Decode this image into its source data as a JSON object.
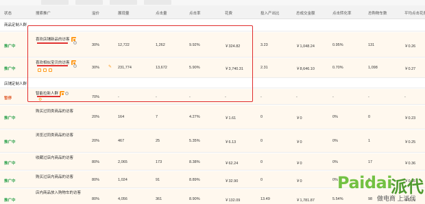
{
  "header": {
    "columns": [
      "状态",
      "搜索推广",
      "溢价",
      "展现量",
      "点击量",
      "点击率",
      "花费",
      "投入产出比",
      "总成交金额",
      "点击转化率",
      "总购物车数",
      "平均点击花费"
    ]
  },
  "groups": {
    "shop_custom": "商品定制人群",
    "store_custom": "店铺定制人群"
  },
  "rows": [
    {
      "status": "推广中",
      "name": "喜欢店铺新品的访客",
      "premium": "30%",
      "impressions": "12,722",
      "clicks": "1,262",
      "ctr": "9.92%",
      "cost": "￥324.82",
      "roi": "3.23",
      "gmv": "￥1,048.24",
      "cvr": "0.95%",
      "carts": "131",
      "cpc": "￥0.26"
    },
    {
      "status": "推广中",
      "name": "喜欢相似宝贝的访客",
      "premium": "30%",
      "impressions": "231,774",
      "clicks": "13,672",
      "ctr": "5.90%",
      "cost": "￥3,740.31",
      "roi": "2.31",
      "gmv": "￥8,646.10",
      "cvr": "0.70%",
      "carts": "1,098",
      "cpc": "￥0.27"
    },
    {
      "status": "暂停",
      "name": "智能拉新人群",
      "premium": "70%",
      "impressions": "-",
      "clicks": "-",
      "ctr": "-",
      "cost": "-",
      "roi": "-",
      "gmv": "-",
      "cvr": "-",
      "carts": "-",
      "cpc": "-"
    },
    {
      "status": "推广中",
      "name": "购买过同类商品的访客",
      "premium": "20%",
      "impressions": "164",
      "clicks": "7",
      "ctr": "4.27%",
      "cost": "￥1.61",
      "roi": "0",
      "gmv": "￥0",
      "cvr": "0%",
      "carts": "0",
      "cpc": "￥0.23"
    },
    {
      "status": "推广中",
      "name": "浏览过同类商品的访客",
      "premium": "20%",
      "impressions": "467",
      "clicks": "25",
      "ctr": "5.35%",
      "cost": "￥6.13",
      "roi": "0",
      "gmv": "￥0",
      "cvr": "0%",
      "carts": "1",
      "cpc": "￥0.25"
    },
    {
      "status": "推广中",
      "name": "收藏过店内商品的访客",
      "premium": "80%",
      "impressions": "2,065",
      "clicks": "173",
      "ctr": "8.38%",
      "cost": "￥62.24",
      "roi": "0",
      "gmv": "￥0",
      "cvr": "0%",
      "carts": "17",
      "cpc": "￥0.36"
    },
    {
      "status": "推广中",
      "name": "购买过店内商品的访客",
      "premium": "80%",
      "impressions": "1,024",
      "clicks": "91",
      "ctr": "8.89%",
      "cost": "￥32.90",
      "roi": "0",
      "gmv": "￥0",
      "cvr": "0%",
      "carts": "8",
      "cpc": "￥0.36"
    },
    {
      "status": "推广中",
      "name": "店内商品放入购物车的访客",
      "premium": "80%",
      "impressions": "4,056",
      "clicks": "361",
      "ctr": "8.90%",
      "cost": "￥132.09",
      "roi": "13.49",
      "gmv": "￥1,781.87",
      "cvr": "5.54%",
      "carts": "98",
      "cpc": "￥0.37"
    }
  ],
  "watermark": {
    "brand": "Paidai",
    "brand_cn": "派代",
    "tagline": "做电商 上派代"
  },
  "colors": {
    "status_active": "#2aa04a",
    "status_paused": "#e06030",
    "highlight_box": "#e02a2a",
    "row_bg": "#fff8ee"
  }
}
